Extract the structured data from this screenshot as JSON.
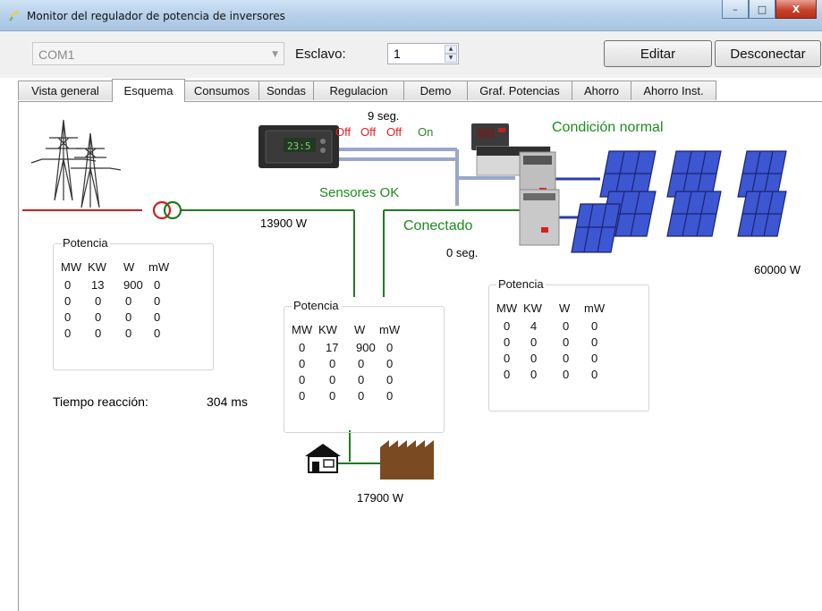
{
  "window": {
    "title": "Monitor del regulador de potencia de inversores",
    "controls": [
      "–",
      "□",
      "X"
    ]
  },
  "toolbar": {
    "port_value": "COM1",
    "slave_label": "Esclavo:",
    "slave_value": "1",
    "edit_label": "Editar",
    "disconnect_label": "Desconectar"
  },
  "tabs": [
    {
      "label": "Vista general"
    },
    {
      "label": "Esquema",
      "active": true
    },
    {
      "label": "Consumos"
    },
    {
      "label": "Sondas"
    },
    {
      "label": "Regulacion"
    },
    {
      "label": "Demo"
    },
    {
      "label": "Graf. Potencias"
    },
    {
      "label": "Ahorro"
    },
    {
      "label": "Ahorro Inst."
    }
  ],
  "schema": {
    "timer_top": "9 seg.",
    "relays": [
      "Off",
      "Off",
      "Off",
      "On"
    ],
    "relay_colors": [
      "#e32020",
      "#e32020",
      "#e32020",
      "#1e8a1e"
    ],
    "status_normal": "Condición normal",
    "sensors_status": "Sensores OK",
    "connection_status": "Conectado",
    "timer_conn": "0 seg.",
    "grid_power": "13900 W",
    "solar_power": "60000 W",
    "load_power": "17900 W",
    "reaction_label": "Tiempo reacción:",
    "reaction_value": "304 ms",
    "panels": {
      "grid": {
        "title": "Potencia",
        "headers": [
          "MW",
          "KW",
          "W",
          "mW"
        ],
        "rows": [
          [
            "0",
            "13",
            "900",
            "0"
          ],
          [
            "0",
            "0",
            "0",
            "0"
          ],
          [
            "0",
            "0",
            "0",
            "0"
          ],
          [
            "0",
            "0",
            "0",
            "0"
          ]
        ]
      },
      "load": {
        "title": "Potencia",
        "headers": [
          "MW",
          "KW",
          "W",
          "mW"
        ],
        "rows": [
          [
            "0",
            "17",
            "900",
            "0"
          ],
          [
            "0",
            "0",
            "0",
            "0"
          ],
          [
            "0",
            "0",
            "0",
            "0"
          ],
          [
            "0",
            "0",
            "0",
            "0"
          ]
        ]
      },
      "solar": {
        "title": "Potencia",
        "headers": [
          "MW",
          "KW",
          "W",
          "mW"
        ],
        "rows": [
          [
            "0",
            "4",
            "0",
            "0"
          ],
          [
            "0",
            "0",
            "0",
            "0"
          ],
          [
            "0",
            "0",
            "0",
            "0"
          ],
          [
            "0",
            "0",
            "0",
            "0"
          ]
        ]
      }
    },
    "colors": {
      "status_green": "#1e8a1e",
      "line_green": "#1e7a1e",
      "bus_blue": "#9aa6cc",
      "panel_blue": "#2a3ea8",
      "factory_brown": "#7a4a22",
      "transformer_red": "#cc1f1f"
    }
  }
}
